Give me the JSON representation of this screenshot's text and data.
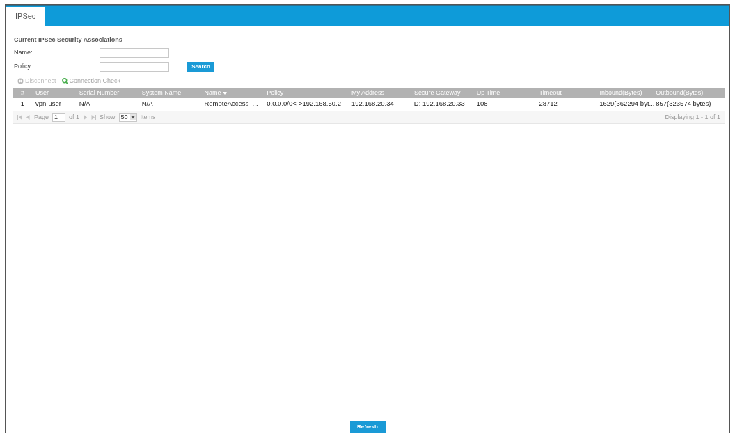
{
  "tabs": [
    {
      "label": "IPSec",
      "selected": true
    }
  ],
  "section": {
    "title": "Current IPSec Security Associations",
    "filters": [
      {
        "label": "Name:"
      },
      {
        "label": "Policy:"
      }
    ],
    "search_button": "Search"
  },
  "table": {
    "toolbar": [
      {
        "kind": "disconnect",
        "label": "Disconnect",
        "disabled": true
      },
      {
        "kind": "check",
        "label": "Connection Check",
        "disabled": false
      }
    ],
    "columns": [
      {
        "label": "#",
        "sorted": false
      },
      {
        "label": "User",
        "sorted": false
      },
      {
        "label": "Serial Number",
        "sorted": false
      },
      {
        "label": "System Name",
        "sorted": false
      },
      {
        "label": "Name",
        "sorted": true
      },
      {
        "label": "Policy",
        "sorted": false
      },
      {
        "label": "My Address",
        "sorted": false
      },
      {
        "label": "Secure Gateway",
        "sorted": false
      },
      {
        "label": "Up Time",
        "sorted": false
      },
      {
        "label": "Timeout",
        "sorted": false
      },
      {
        "label": "Inbound(Bytes)",
        "sorted": false
      },
      {
        "label": "Outbound(Bytes)",
        "sorted": false
      }
    ],
    "rows": [
      {
        "cells": [
          "1",
          "vpn-user",
          "N/A",
          "N/A",
          "RemoteAccess_...",
          "0.0.0.0/0<->192.168.50.2",
          "192.168.20.34",
          "D: 192.168.20.33",
          "108",
          "28712",
          "1629(362294 byt...",
          "857(323574 bytes)"
        ]
      }
    ],
    "pager": {
      "page_label": "Page",
      "page": "1",
      "of_label": "of 1",
      "show_label": "Show",
      "page_size": "50",
      "items_label": "Items",
      "summary": "Displaying 1 - 1 of 1"
    }
  },
  "refresh_button": "Refresh"
}
